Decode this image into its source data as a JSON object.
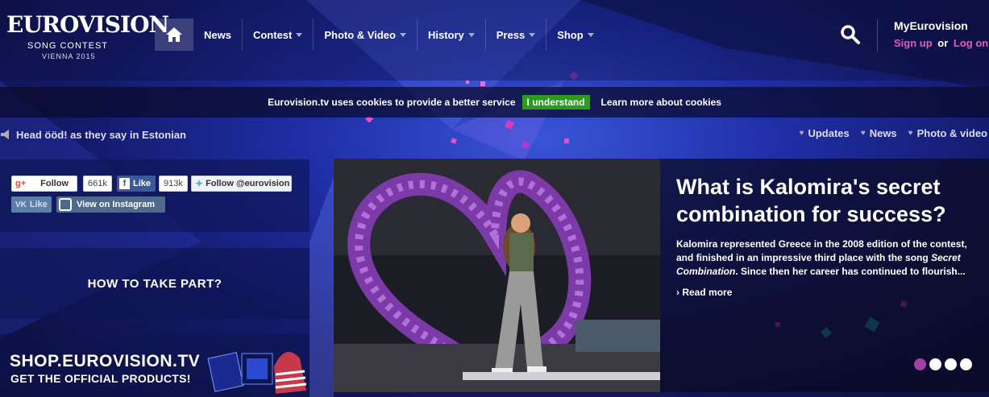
{
  "header": {
    "logo": {
      "title": "EUROVISION",
      "line1": "SONG CONTEST",
      "line2": "VIENNA 2015"
    },
    "nav": [
      {
        "label": "News",
        "has_dropdown": false
      },
      {
        "label": "Contest",
        "has_dropdown": true
      },
      {
        "label": "Photo & Video",
        "has_dropdown": true
      },
      {
        "label": "History",
        "has_dropdown": true
      },
      {
        "label": "Press",
        "has_dropdown": true
      },
      {
        "label": "Shop",
        "has_dropdown": true
      }
    ],
    "account": {
      "title": "MyEurovision",
      "signup": "Sign up",
      "or": "or",
      "login": "Log on"
    }
  },
  "cookie": {
    "message": "Eurovision.tv uses cookies to provide a better service",
    "accept": "I understand",
    "learn_more": "Learn more about cookies"
  },
  "ticker": {
    "text": "Head ööd! as they say in Estonian"
  },
  "quick_links": [
    "Updates",
    "News",
    "Photo & video"
  ],
  "social": {
    "gplus_label": "Follow",
    "gplus_count": "661k",
    "fb_label": "Like",
    "fb_count": "913k",
    "twitter_label": "Follow @eurovision",
    "vk_label": "Like",
    "instagram_label": "View on Instagram"
  },
  "promo": {
    "take_part": "HOW TO TAKE PART?",
    "shop_title": "SHOP.EUROVISION.TV",
    "shop_sub": "GET THE OFFICIAL PRODUCTS!"
  },
  "feature": {
    "title": "What is Kalomira's secret combination for success?",
    "desc_1": "Kalomira represented Greece in the 2008 edition of the contest, and finished in an impressive third place with the song ",
    "desc_song": "Secret Combination",
    "desc_2": ". Since then her career has continued to flourish...",
    "read_more": "Read more",
    "slides": {
      "total": 4,
      "active": 1
    }
  },
  "colors": {
    "accent_pink": "#e65bb8",
    "cookie_green": "#2a9a20",
    "active_dot": "#a23fa8",
    "facebook": "#3b5998",
    "twitter": "#55acee",
    "vk": "#5b7fa6"
  },
  "icons": [
    "home-icon",
    "search-icon",
    "chevron-down-icon",
    "heart-icon",
    "megaphone-icon",
    "google-plus-icon",
    "facebook-icon",
    "twitter-icon",
    "vk-icon",
    "instagram-icon"
  ]
}
